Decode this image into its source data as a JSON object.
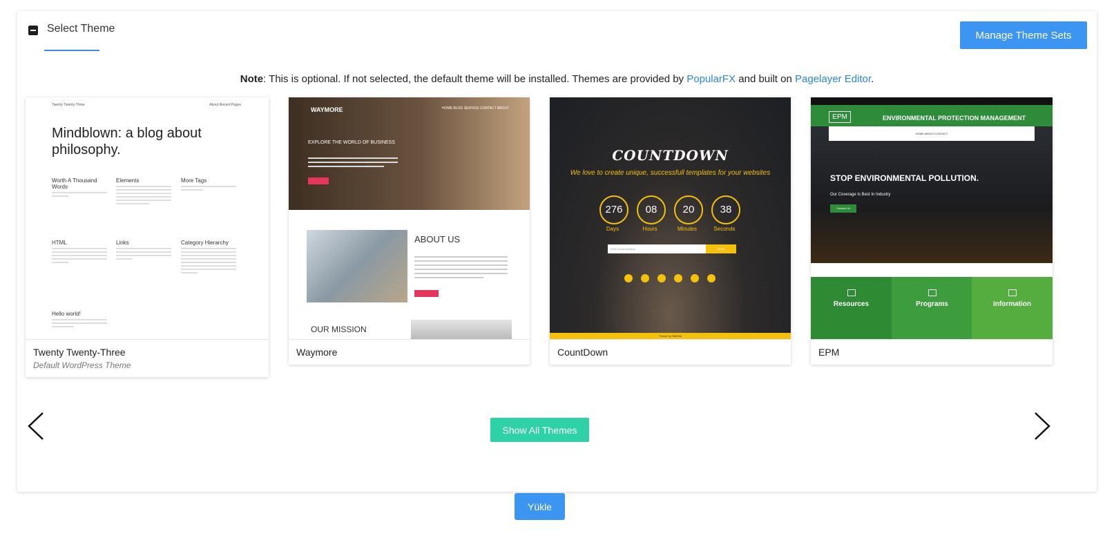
{
  "panel": {
    "title": "Select Theme",
    "manage_button": "Manage Theme Sets"
  },
  "note": {
    "label": "Note",
    "text_before": ": This is optional. If not selected, the default theme will be installed. Themes are provided by ",
    "link1": "PopularFX",
    "text_middle": " and built on ",
    "link2": "Pagelayer Editor",
    "text_after": "."
  },
  "themes": [
    {
      "name": "Twenty Twenty-Three",
      "subtitle": "Default WordPress Theme",
      "preview": {
        "site_name": "Twenty Twenty-Three",
        "nav": "About    Recent Pages",
        "headline": "Mindblown: a blog about philosophy.",
        "posts": [
          "Worth A Thousand Words",
          "Elements",
          "More Tags",
          "HTML",
          "Links",
          "Category Hierarchy",
          "Hello world!"
        ]
      }
    },
    {
      "name": "Waymore",
      "preview": {
        "logo": "WAYMORE",
        "nav": "HOME   BLOG   SERVICE   CONTACT   ABOUT",
        "hero_text": "EXPLORE THE WORLD OF BUSINESS",
        "section1": "ABOUT US",
        "section2": "OUR MISSION"
      }
    },
    {
      "name": "CountDown",
      "preview": {
        "title": "COUNTDOWN",
        "tagline": "We love to create unique, successfull templates for your websites",
        "counters": [
          {
            "value": "276",
            "label": "Days"
          },
          {
            "value": "08",
            "label": "Hours"
          },
          {
            "value": "20",
            "label": "Minutes"
          },
          {
            "value": "38",
            "label": "Seconds"
          }
        ],
        "email_placeholder": "Enter Email Address",
        "send": "SEND",
        "footer": "Theme by SitePad"
      }
    },
    {
      "name": "EPM",
      "preview": {
        "logo": "EPM",
        "title": "ENVIRONMENTAL PROTECTION MANAGEMENT",
        "menu": "HOME    ABOUT    CONTACT",
        "headline": "STOP ENVIRONMENTAL POLLUTION.",
        "subline": "Our Coverage Is Best In Industry",
        "cta": "Contact Us",
        "blocks": [
          "Resources",
          "Programs",
          "Information"
        ]
      }
    }
  ],
  "show_all_button": "Show All Themes",
  "install_button": "Yükle",
  "colors": {
    "accent_blue": "#3c95f0",
    "teal": "#2fd1a6",
    "link": "#2a86d8"
  }
}
